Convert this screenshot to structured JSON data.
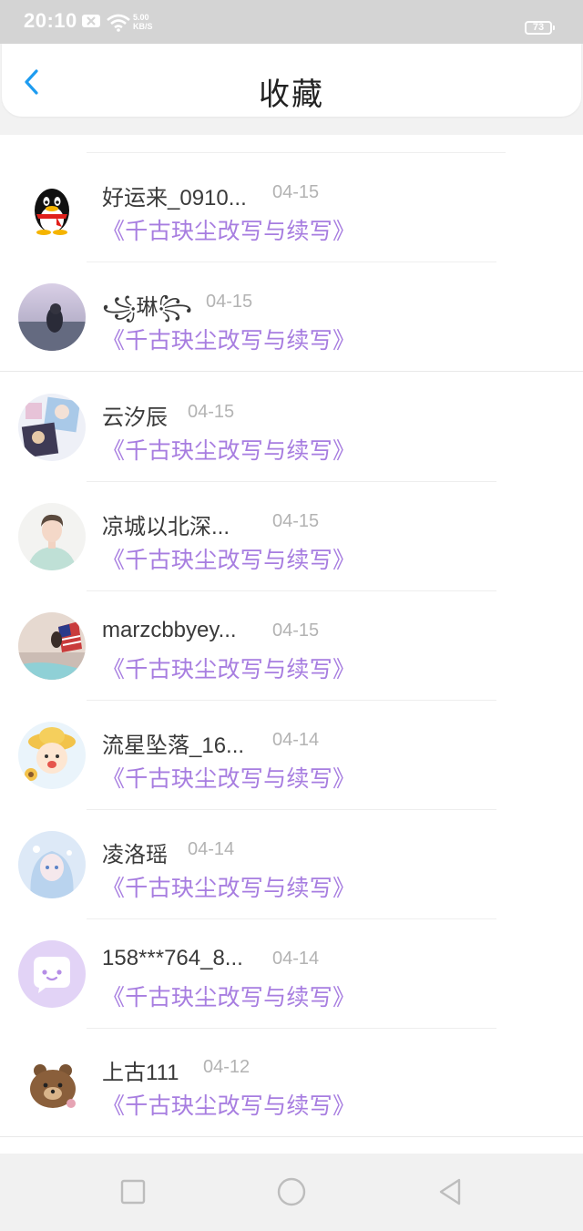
{
  "status_bar": {
    "time": "20:10",
    "net_speed_value": "5.00",
    "net_speed_unit": "KB/S",
    "battery": "73",
    "icons": [
      "notification-x-icon",
      "wifi-icon",
      "battery-icon"
    ]
  },
  "header": {
    "title": "收藏",
    "back_icon": "chevron-left-icon"
  },
  "favorites": [
    {
      "name": "好运来_0910...",
      "date": "04-15",
      "work": "《千古玦尘改写与续写》",
      "avatar": "qq-penguin"
    },
    {
      "name": "꧁琳꧂",
      "date": "04-15",
      "work": "《千古玦尘改写与续写》",
      "avatar": "photo-seaside-girl"
    },
    {
      "name": "云汐辰",
      "date": "04-15",
      "work": "《千古玦尘改写与续写》",
      "avatar": "anime-collage"
    },
    {
      "name": "凉城以北深...",
      "date": "04-15",
      "work": "《千古玦尘改写与续写》",
      "avatar": "photo-young-man"
    },
    {
      "name": "marzcbbyey...",
      "date": "04-15",
      "work": "《千古玦尘改写与续写》",
      "avatar": "photo-beach-flag"
    },
    {
      "name": "流星坠落_16...",
      "date": "04-14",
      "work": "《千古玦尘改写与续写》",
      "avatar": "cartoon-boy-hat"
    },
    {
      "name": "凌洛瑶",
      "date": "04-14",
      "work": "《千古玦尘改写与续写》",
      "avatar": "anime-blue-girl"
    },
    {
      "name": "158***764_8...",
      "date": "04-14",
      "work": "《千古玦尘改写与续写》",
      "avatar": "chat-bubble-default"
    },
    {
      "name": "上古111",
      "date": "04-12",
      "work": "《千古玦尘改写与续写》",
      "avatar": "cartoon-bear"
    }
  ],
  "navbar": {
    "icons": [
      "recent-apps-square-icon",
      "home-circle-icon",
      "back-triangle-icon"
    ]
  },
  "colors": {
    "accent_link": "#a77de0",
    "back_arrow": "#1e9cf0",
    "status_bar": "#d4d4d4",
    "date_text": "#b3b3b3"
  }
}
